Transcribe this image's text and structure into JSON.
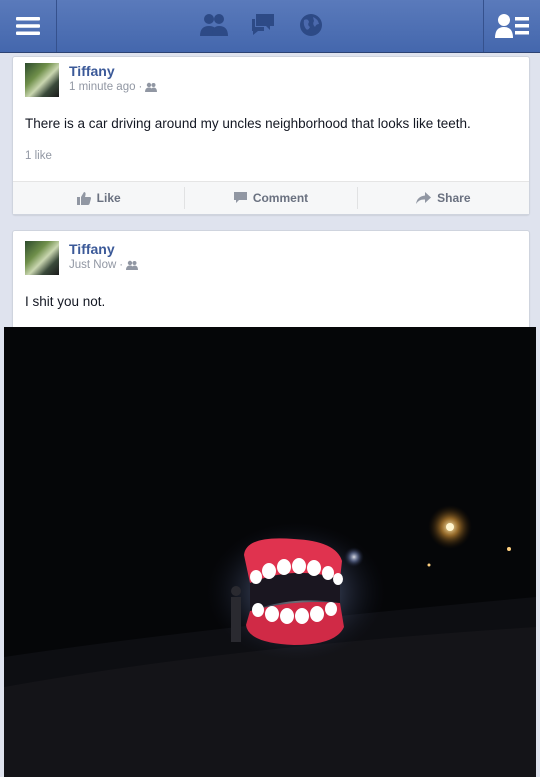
{
  "topbar": {
    "menu_icon": "hamburger-menu-icon",
    "jewels": [
      "friend-requests-icon",
      "messages-icon",
      "notifications-globe-icon"
    ],
    "right_icon": "friends-list-icon"
  },
  "colors": {
    "brand": "#3b5998",
    "bar": "#4b69ad",
    "meta": "#9197a3"
  },
  "posts": [
    {
      "author": "Tiffany",
      "time": "1 minute ago",
      "text": "There is a car driving around my uncles neighborhood that looks like teeth.",
      "likes": "1 like",
      "actions": {
        "like": "Like",
        "comment": "Comment",
        "share": "Share"
      }
    },
    {
      "author": "Tiffany",
      "time": "Just Now",
      "text": "I shit you not."
    }
  ]
}
